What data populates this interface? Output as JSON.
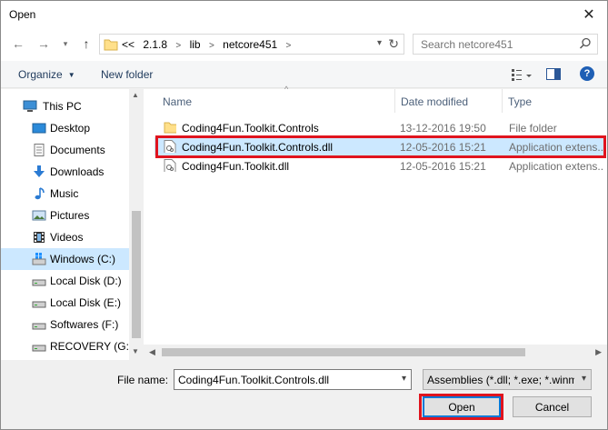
{
  "window": {
    "title": "Open",
    "close_glyph": "✕"
  },
  "address": {
    "crumbs": [
      "<<",
      "2.1.8",
      "lib",
      "netcore451"
    ],
    "separator": ">",
    "search_placeholder": "Search netcore451"
  },
  "toolbar": {
    "organize_label": "Organize",
    "new_folder_label": "New folder",
    "help_label": "?"
  },
  "nav": {
    "items": [
      {
        "label": "This PC",
        "icon": "computer-icon"
      },
      {
        "label": "Desktop",
        "icon": "desktop-icon"
      },
      {
        "label": "Documents",
        "icon": "documents-icon"
      },
      {
        "label": "Downloads",
        "icon": "downloads-icon"
      },
      {
        "label": "Music",
        "icon": "music-icon"
      },
      {
        "label": "Pictures",
        "icon": "pictures-icon"
      },
      {
        "label": "Videos",
        "icon": "videos-icon"
      },
      {
        "label": "Windows (C:)",
        "icon": "windows-drive-icon",
        "selected": true
      },
      {
        "label": "Local Disk (D:)",
        "icon": "drive-icon"
      },
      {
        "label": "Local Disk (E:)",
        "icon": "drive-icon"
      },
      {
        "label": "Softwares (F:)",
        "icon": "drive-icon"
      },
      {
        "label": "RECOVERY (G:)",
        "icon": "drive-icon"
      }
    ]
  },
  "files": {
    "columns": {
      "name": "Name",
      "date": "Date modified",
      "type": "Type"
    },
    "rows": [
      {
        "name": "Coding4Fun.Toolkit.Controls",
        "date": "13-12-2016 19:50",
        "type": "File folder",
        "icon": "folder-icon"
      },
      {
        "name": "Coding4Fun.Toolkit.Controls.dll",
        "date": "12-05-2016 15:21",
        "type": "Application extens...",
        "icon": "dll-file-icon",
        "selected": true
      },
      {
        "name": "Coding4Fun.Toolkit.dll",
        "date": "12-05-2016 15:21",
        "type": "Application extens...",
        "icon": "dll-file-icon"
      }
    ]
  },
  "bottom": {
    "file_name_label": "File name:",
    "file_name_value": "Coding4Fun.Toolkit.Controls.dll",
    "file_type_value": "Assemblies (*.dll; *.exe; *.winmd)",
    "open_label": "Open",
    "cancel_label": "Cancel"
  },
  "colors": {
    "selection": "#cce8ff",
    "highlight_red": "#e0141e",
    "accent": "#0078d7"
  }
}
